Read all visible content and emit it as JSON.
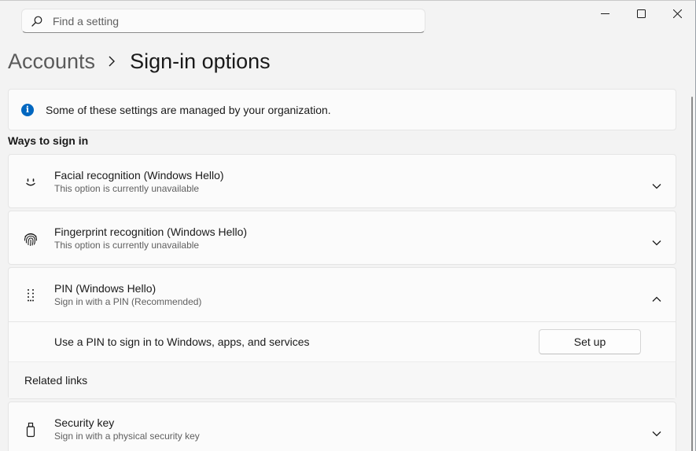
{
  "search": {
    "placeholder": "Find a setting",
    "icon": "search-icon"
  },
  "window_controls": {
    "minimize_icon": "minimize-icon",
    "maximize_icon": "maximize-icon",
    "close_icon": "close-icon"
  },
  "breadcrumb": {
    "parent": "Accounts",
    "current": "Sign-in options"
  },
  "info_banner": {
    "text": "Some of these settings are managed by your organization.",
    "icon": "info-icon"
  },
  "section_title": "Ways to sign in",
  "options": [
    {
      "title": "Facial recognition (Windows Hello)",
      "subtitle": "This option is currently unavailable",
      "icon": "face-icon",
      "expanded": false
    },
    {
      "title": "Fingerprint recognition (Windows Hello)",
      "subtitle": "This option is currently unavailable",
      "icon": "fingerprint-icon",
      "expanded": false
    },
    {
      "title": "PIN (Windows Hello)",
      "subtitle": "Sign in with a PIN (Recommended)",
      "icon": "pin-keypad-icon",
      "expanded": true
    },
    {
      "title": "Security key",
      "subtitle": "Sign in with a physical security key",
      "icon": "security-key-icon",
      "expanded": false
    }
  ],
  "pin_expanded": {
    "description": "Use a PIN to sign in to Windows, apps, and services",
    "button_label": "Set up",
    "related_links_label": "Related links"
  },
  "colors": {
    "accent": "#0067c0",
    "background": "#f3f3f3",
    "card": "#fbfbfb"
  }
}
